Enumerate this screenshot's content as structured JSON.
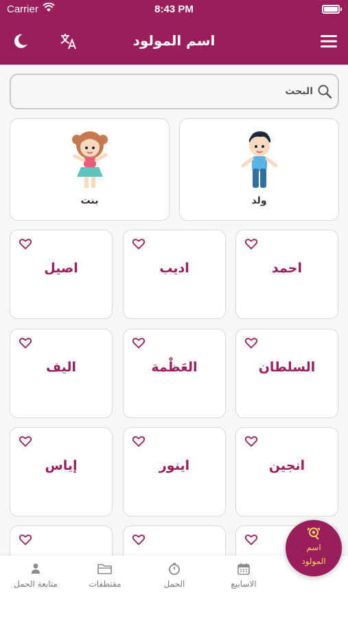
{
  "status_bar": {
    "carrier": "Carrier",
    "time": "8:43 PM"
  },
  "header": {
    "title": "اسم المولود",
    "left_icons": [
      "moon-icon",
      "translate-icon"
    ],
    "right_icon": "menu-icon"
  },
  "search": {
    "placeholder": "البحث"
  },
  "genders": [
    {
      "label": "ولد",
      "icon": "boy-icon"
    },
    {
      "label": "بنت",
      "icon": "girl-icon"
    }
  ],
  "names": [
    "احمد",
    "اديب",
    "اصيل",
    "السلطان",
    "العَظْمة",
    "اليف",
    "انجين",
    "اينور",
    "إياس",
    "",
    "",
    ""
  ],
  "tabs": [
    {
      "label": "الاسابيع",
      "icon": "calendar-icon"
    },
    {
      "label": "الحمل",
      "icon": "timer-icon"
    },
    {
      "label": "مقتطفات",
      "icon": "folder-icon"
    },
    {
      "label": "متابعة الحمل",
      "icon": "person-icon"
    }
  ],
  "fab": {
    "label": "اسم\nالمولود",
    "icon": "baby-rattle-icon"
  },
  "colors": {
    "primary": "#9a1e5c",
    "accent": "#ffd35a",
    "background": "#f7f7f7"
  }
}
